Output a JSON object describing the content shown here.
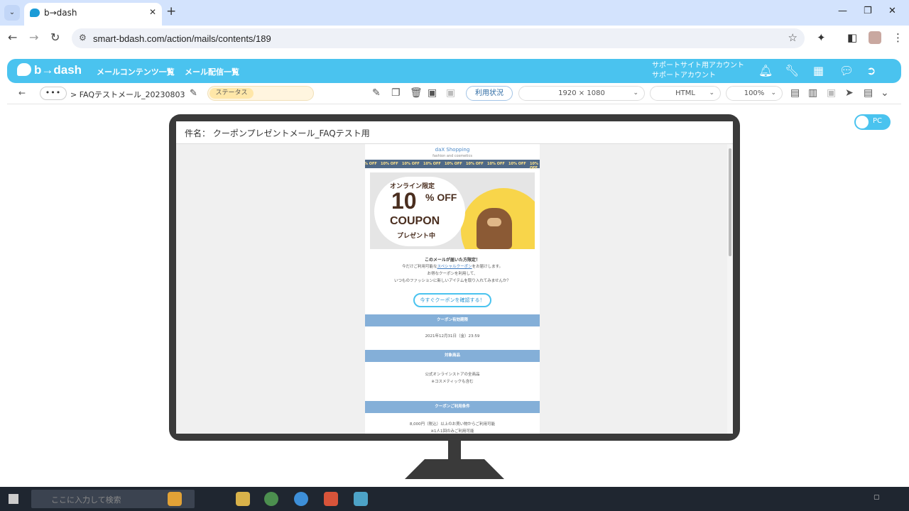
{
  "browser": {
    "tab_title": "b→dash",
    "url": "smart-bdash.com/action/mails/contents/189"
  },
  "app": {
    "logo": "b→dash",
    "nav": [
      "メールコンテンツ一覧",
      "メール配信一覧"
    ],
    "account_line1": "サポートサイト用アカウント",
    "account_line2": "サポートアカウント"
  },
  "toolbar": {
    "dots": "•••",
    "breadcrumb": "> FAQテストメール_20230803",
    "status_label": "ステータス",
    "usage_button": "利用状況",
    "resolution": "1920 × 1080",
    "format": "HTML",
    "zoom": "100%"
  },
  "preview": {
    "device_toggle": "PC",
    "subject": "件名： クーポンプレゼントメール_FAQテスト用"
  },
  "email": {
    "brand": "daX Shopping",
    "tagline": "fashion and cosmetics",
    "strip_text": "10% OFF",
    "hero_line1": "オンライン限定",
    "hero_percent": "10",
    "hero_off": "% OFF",
    "hero_coupon": "COUPON",
    "hero_present": "プレゼント中",
    "lead": "このメールが届いた方限定！",
    "body1": "今だけご利用可能な",
    "body1_link": "スペシャルクーポン",
    "body1_tail": "をお届けします。",
    "body2": "お得なクーポンを利用して、",
    "body3": "いつものファッションに新しいアイテムを取り入れてみませんか？",
    "cta": "今すぐクーポンを確認する！",
    "sec1_title": "クーポン有効期限",
    "sec1_value": "2021年12月31日（金）23:59",
    "sec2_title": "対象商品",
    "sec2_value1": "公式オンラインストアの全商品",
    "sec2_value2": "※コスメティックも含む",
    "sec3_title": "クーポンご利用条件",
    "sec3_value1": "8,000円（税込）以上のお買い物からご利用可能",
    "sec3_value2": "※1人1回のみご利用可能"
  },
  "taskbar": {
    "search_placeholder": "ここに入力して検索"
  }
}
